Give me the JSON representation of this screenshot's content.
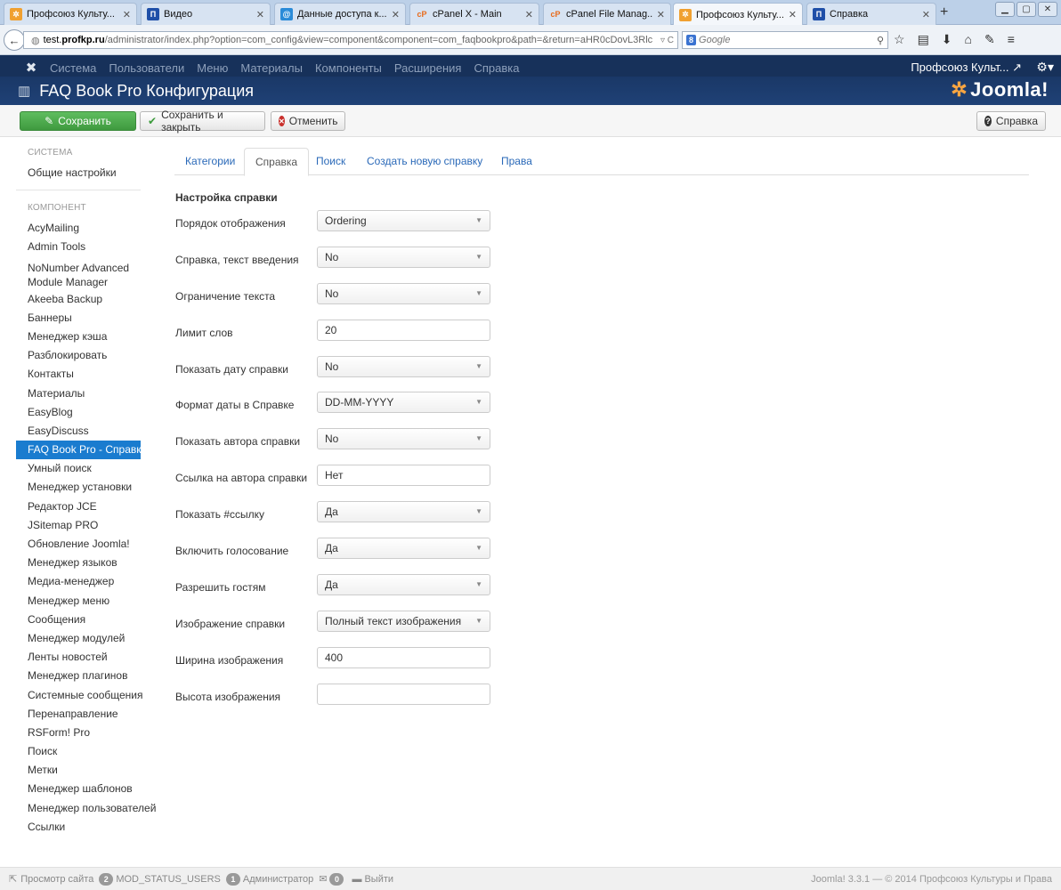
{
  "browser": {
    "tabs": [
      {
        "label": "Профсоюз Культу...",
        "icon": "joomla-icon",
        "color": "#f0a030",
        "active": false
      },
      {
        "label": "Видео",
        "icon": "site-logo-icon",
        "color": "#1f4fa8",
        "active": false
      },
      {
        "label": "Данные доступа к...",
        "icon": "mail-icon",
        "color": "#2a8bd8",
        "active": false
      },
      {
        "label": "cPanel X - Main",
        "icon": "cpanel-icon",
        "color": "#e86b1c",
        "active": false
      },
      {
        "label": "cPanel File Manag...",
        "icon": "cpanel-icon",
        "color": "#e86b1c",
        "active": false
      },
      {
        "label": "Профсоюз Культу...",
        "icon": "joomla-icon",
        "color": "#f0a030",
        "active": true
      },
      {
        "label": "Справка",
        "icon": "site-logo-icon",
        "color": "#1f4fa8",
        "active": false
      }
    ],
    "url_host": "test.",
    "url_host_bold": "profkp.ru",
    "url_path": "/administrator/index.php?option=com_config&view=component&component=com_faqbookpro&path=&return=aHR0cDovL3Rlc",
    "search_placeholder": "Google",
    "search_engine_badge": "8"
  },
  "joomla": {
    "menu": [
      "Система",
      "Пользователи",
      "Меню",
      "Материалы",
      "Компоненты",
      "Расширения",
      "Справка"
    ],
    "user": "Профсоюз Культ... ↗",
    "page_title": "FAQ Book Pro Конфигурация",
    "wordmark": "Joomla!"
  },
  "toolbar": {
    "save": "Сохранить",
    "save_close": "Сохранить и закрыть",
    "cancel": "Отменить",
    "help": "Справка"
  },
  "sidebar": {
    "system_heading": "СИСТЕМА",
    "system_items": [
      "Общие настройки"
    ],
    "component_heading": "КОМПОНЕНТ",
    "component_items": [
      "AcyMailing",
      "Admin Tools",
      "NoNumber Advanced Module Manager",
      "Akeeba Backup",
      "Баннеры",
      "Менеджер кэша",
      "Разблокировать",
      "Контакты",
      "Материалы",
      "EasyBlog",
      "EasyDiscuss",
      "FAQ Book Pro - Справка",
      "Умный поиск",
      "Менеджер установки",
      "Редактор JCE",
      "JSitemap PRO",
      "Обновление Joomla!",
      "Менеджер языков",
      "Медиа-менеджер",
      "Менеджер меню",
      "Сообщения",
      "Менеджер модулей",
      "Ленты новостей",
      "Менеджер плагинов",
      "Системные сообщения",
      "Перенаправление",
      "RSForm! Pro",
      "Поиск",
      "Метки",
      "Менеджер шаблонов",
      "Менеджер пользователей",
      "Ссылки"
    ],
    "active_item": "FAQ Book Pro - Справка"
  },
  "tabs": [
    "Категории",
    "Справка",
    "Поиск",
    "Создать новую справку",
    "Права"
  ],
  "active_tab": "Справка",
  "form": {
    "section_title": "Настройка справки",
    "fields": [
      {
        "label": "Порядок отображения",
        "type": "select",
        "value": "Ordering"
      },
      {
        "label": "Справка, текст введения",
        "type": "select",
        "value": "No"
      },
      {
        "label": "Ограничение текста",
        "type": "select",
        "value": "No"
      },
      {
        "label": "Лимит слов",
        "type": "text",
        "value": "20"
      },
      {
        "label": "Показать дату справки",
        "type": "select",
        "value": "No"
      },
      {
        "label": "Формат даты в Справке",
        "type": "select",
        "value": "DD-MM-YYYY"
      },
      {
        "label": "Показать автора справки",
        "type": "select",
        "value": "No"
      },
      {
        "label": "Ссылка на автора справки",
        "type": "text",
        "value": "Нет"
      },
      {
        "label": "Показать #ссылку",
        "type": "select",
        "value": "Да"
      },
      {
        "label": "Включить голосование",
        "type": "select",
        "value": "Да"
      },
      {
        "label": "Разрешить гостям",
        "type": "select",
        "value": "Да"
      },
      {
        "label": "Изображение справки",
        "type": "select",
        "value": "Полный текст изображения"
      },
      {
        "label": "Ширина изображения",
        "type": "text",
        "value": "400"
      },
      {
        "label": "Высота изображения",
        "type": "text",
        "value": ""
      }
    ]
  },
  "statusbar": {
    "view_site": "Просмотр сайта",
    "users_count": "2",
    "users_label": "MOD_STATUS_USERS",
    "admin_count": "1",
    "admin_label": "Администратор",
    "mail_count": "0",
    "logout": "Выйти",
    "footer": "Joomla! 3.3.1 — © 2014 Профсоюз Культуры и Права"
  },
  "colors": {
    "joomla_nav": "#17315a",
    "save_button": "#4cae4c",
    "active_sidebar": "#1a7ccf",
    "link": "#2a69b8"
  }
}
